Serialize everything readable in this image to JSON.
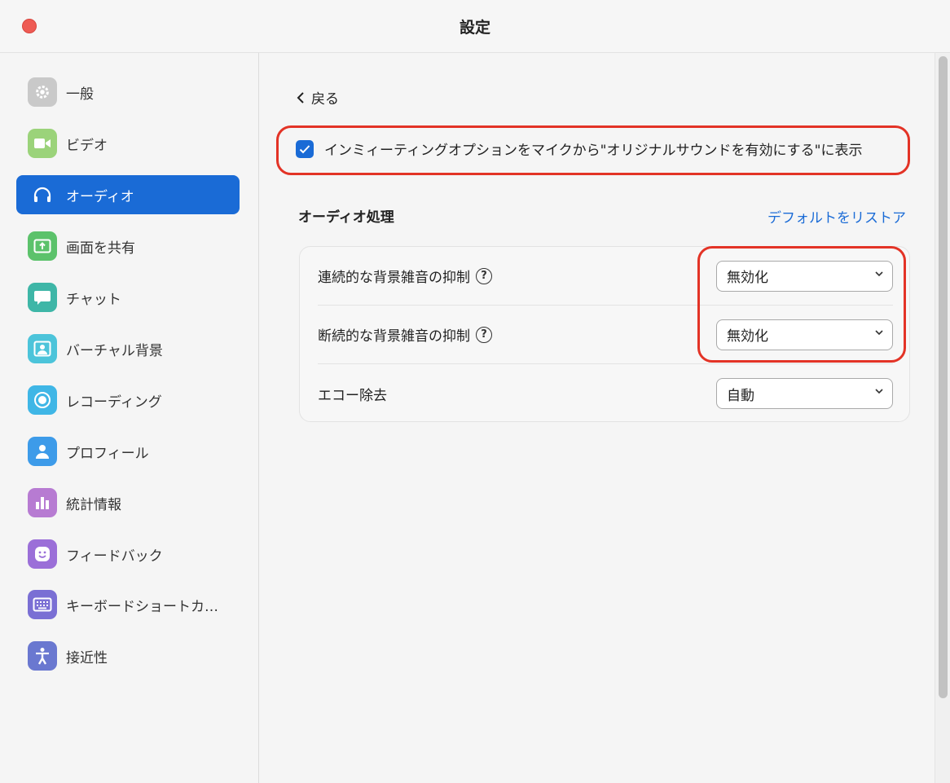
{
  "window": {
    "title": "設定"
  },
  "sidebar": {
    "items": [
      {
        "label": "一般",
        "icon": "gear-icon",
        "color": "#c9c9c9"
      },
      {
        "label": "ビデオ",
        "icon": "video-camera-icon",
        "color": "#9bd37a"
      },
      {
        "label": "オーディオ",
        "icon": "headphones-icon",
        "color": "#1a6bd6",
        "active": true
      },
      {
        "label": "画面を共有",
        "icon": "share-screen-icon",
        "color": "#5cc26b"
      },
      {
        "label": "チャット",
        "icon": "chat-bubble-icon",
        "color": "#3eb6a7"
      },
      {
        "label": "バーチャル背景",
        "icon": "person-background-icon",
        "color": "#4cc4da"
      },
      {
        "label": "レコーディング",
        "icon": "record-icon",
        "color": "#3fb6e6"
      },
      {
        "label": "プロフィール",
        "icon": "profile-icon",
        "color": "#3d9be9"
      },
      {
        "label": "統計情報",
        "icon": "bar-chart-icon",
        "color": "#b77bd2"
      },
      {
        "label": "フィードバック",
        "icon": "smile-icon",
        "color": "#9b6fd8"
      },
      {
        "label": "キーボードショートカ…",
        "icon": "keyboard-icon",
        "color": "#7a6fd4"
      },
      {
        "label": "接近性",
        "icon": "accessibility-icon",
        "color": "#6a78d0"
      }
    ]
  },
  "main": {
    "back_label": "戻る",
    "checkbox": {
      "label": "インミィーティングオプションをマイクから\"オリジナルサウンドを有効にする\"に表示",
      "checked": true
    },
    "section_title": "オーディオ処理",
    "restore_link": "デフォルトをリストア",
    "rows": [
      {
        "label": "連続的な背景雑音の抑制",
        "help": true,
        "value": "無効化"
      },
      {
        "label": "断続的な背景雑音の抑制",
        "help": true,
        "value": "無効化"
      },
      {
        "label": "エコー除去",
        "help": false,
        "value": "自動"
      }
    ],
    "help_glyph": "?"
  },
  "colors": {
    "accent": "#1a6bd6",
    "highlight": "#e33326",
    "close_button": "#ee5b54"
  }
}
